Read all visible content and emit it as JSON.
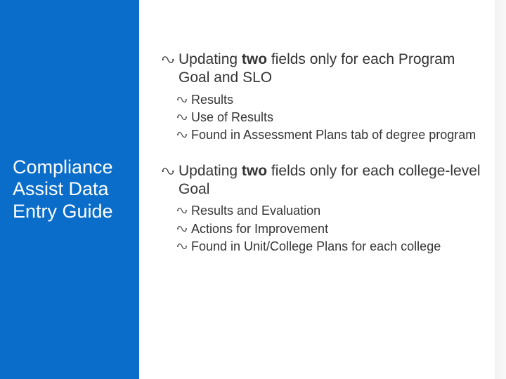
{
  "sidebar": {
    "title": "Compliance Assist Data Entry Guide"
  },
  "content": {
    "sections": [
      {
        "head_pre": "Updating ",
        "head_bold": "two",
        "head_post": " fields only for each Program Goal and SLO",
        "subs": [
          "Results",
          "Use of Results",
          "Found in Assessment Plans tab of degree program"
        ]
      },
      {
        "head_pre": "Updating ",
        "head_bold": "two",
        "head_post": " fields only for each college-level Goal",
        "subs": [
          "Results and Evaluation",
          "Actions for Improvement",
          "Found in Unit/College Plans for each college"
        ]
      }
    ]
  }
}
